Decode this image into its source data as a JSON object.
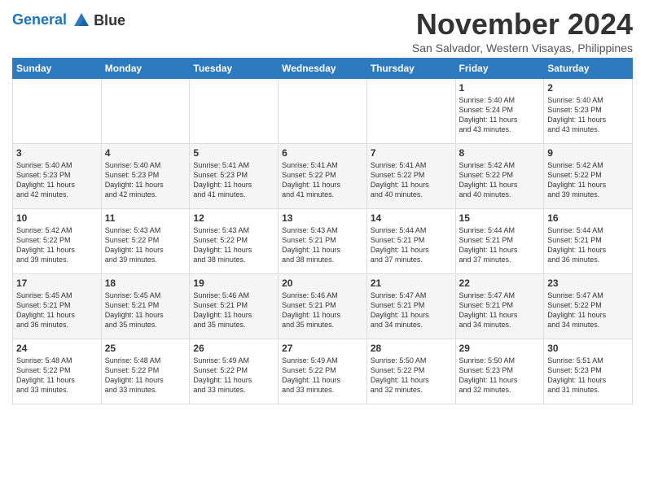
{
  "logo": {
    "line1": "General",
    "line2": "Blue"
  },
  "title": "November 2024",
  "subtitle": "San Salvador, Western Visayas, Philippines",
  "days_of_week": [
    "Sunday",
    "Monday",
    "Tuesday",
    "Wednesday",
    "Thursday",
    "Friday",
    "Saturday"
  ],
  "weeks": [
    [
      {
        "day": "",
        "info": ""
      },
      {
        "day": "",
        "info": ""
      },
      {
        "day": "",
        "info": ""
      },
      {
        "day": "",
        "info": ""
      },
      {
        "day": "",
        "info": ""
      },
      {
        "day": "1",
        "info": "Sunrise: 5:40 AM\nSunset: 5:24 PM\nDaylight: 11 hours\nand 43 minutes."
      },
      {
        "day": "2",
        "info": "Sunrise: 5:40 AM\nSunset: 5:23 PM\nDaylight: 11 hours\nand 43 minutes."
      }
    ],
    [
      {
        "day": "3",
        "info": "Sunrise: 5:40 AM\nSunset: 5:23 PM\nDaylight: 11 hours\nand 42 minutes."
      },
      {
        "day": "4",
        "info": "Sunrise: 5:40 AM\nSunset: 5:23 PM\nDaylight: 11 hours\nand 42 minutes."
      },
      {
        "day": "5",
        "info": "Sunrise: 5:41 AM\nSunset: 5:23 PM\nDaylight: 11 hours\nand 41 minutes."
      },
      {
        "day": "6",
        "info": "Sunrise: 5:41 AM\nSunset: 5:22 PM\nDaylight: 11 hours\nand 41 minutes."
      },
      {
        "day": "7",
        "info": "Sunrise: 5:41 AM\nSunset: 5:22 PM\nDaylight: 11 hours\nand 40 minutes."
      },
      {
        "day": "8",
        "info": "Sunrise: 5:42 AM\nSunset: 5:22 PM\nDaylight: 11 hours\nand 40 minutes."
      },
      {
        "day": "9",
        "info": "Sunrise: 5:42 AM\nSunset: 5:22 PM\nDaylight: 11 hours\nand 39 minutes."
      }
    ],
    [
      {
        "day": "10",
        "info": "Sunrise: 5:42 AM\nSunset: 5:22 PM\nDaylight: 11 hours\nand 39 minutes."
      },
      {
        "day": "11",
        "info": "Sunrise: 5:43 AM\nSunset: 5:22 PM\nDaylight: 11 hours\nand 39 minutes."
      },
      {
        "day": "12",
        "info": "Sunrise: 5:43 AM\nSunset: 5:22 PM\nDaylight: 11 hours\nand 38 minutes."
      },
      {
        "day": "13",
        "info": "Sunrise: 5:43 AM\nSunset: 5:21 PM\nDaylight: 11 hours\nand 38 minutes."
      },
      {
        "day": "14",
        "info": "Sunrise: 5:44 AM\nSunset: 5:21 PM\nDaylight: 11 hours\nand 37 minutes."
      },
      {
        "day": "15",
        "info": "Sunrise: 5:44 AM\nSunset: 5:21 PM\nDaylight: 11 hours\nand 37 minutes."
      },
      {
        "day": "16",
        "info": "Sunrise: 5:44 AM\nSunset: 5:21 PM\nDaylight: 11 hours\nand 36 minutes."
      }
    ],
    [
      {
        "day": "17",
        "info": "Sunrise: 5:45 AM\nSunset: 5:21 PM\nDaylight: 11 hours\nand 36 minutes."
      },
      {
        "day": "18",
        "info": "Sunrise: 5:45 AM\nSunset: 5:21 PM\nDaylight: 11 hours\nand 35 minutes."
      },
      {
        "day": "19",
        "info": "Sunrise: 5:46 AM\nSunset: 5:21 PM\nDaylight: 11 hours\nand 35 minutes."
      },
      {
        "day": "20",
        "info": "Sunrise: 5:46 AM\nSunset: 5:21 PM\nDaylight: 11 hours\nand 35 minutes."
      },
      {
        "day": "21",
        "info": "Sunrise: 5:47 AM\nSunset: 5:21 PM\nDaylight: 11 hours\nand 34 minutes."
      },
      {
        "day": "22",
        "info": "Sunrise: 5:47 AM\nSunset: 5:21 PM\nDaylight: 11 hours\nand 34 minutes."
      },
      {
        "day": "23",
        "info": "Sunrise: 5:47 AM\nSunset: 5:22 PM\nDaylight: 11 hours\nand 34 minutes."
      }
    ],
    [
      {
        "day": "24",
        "info": "Sunrise: 5:48 AM\nSunset: 5:22 PM\nDaylight: 11 hours\nand 33 minutes."
      },
      {
        "day": "25",
        "info": "Sunrise: 5:48 AM\nSunset: 5:22 PM\nDaylight: 11 hours\nand 33 minutes."
      },
      {
        "day": "26",
        "info": "Sunrise: 5:49 AM\nSunset: 5:22 PM\nDaylight: 11 hours\nand 33 minutes."
      },
      {
        "day": "27",
        "info": "Sunrise: 5:49 AM\nSunset: 5:22 PM\nDaylight: 11 hours\nand 33 minutes."
      },
      {
        "day": "28",
        "info": "Sunrise: 5:50 AM\nSunset: 5:22 PM\nDaylight: 11 hours\nand 32 minutes."
      },
      {
        "day": "29",
        "info": "Sunrise: 5:50 AM\nSunset: 5:23 PM\nDaylight: 11 hours\nand 32 minutes."
      },
      {
        "day": "30",
        "info": "Sunrise: 5:51 AM\nSunset: 5:23 PM\nDaylight: 11 hours\nand 31 minutes."
      }
    ]
  ]
}
